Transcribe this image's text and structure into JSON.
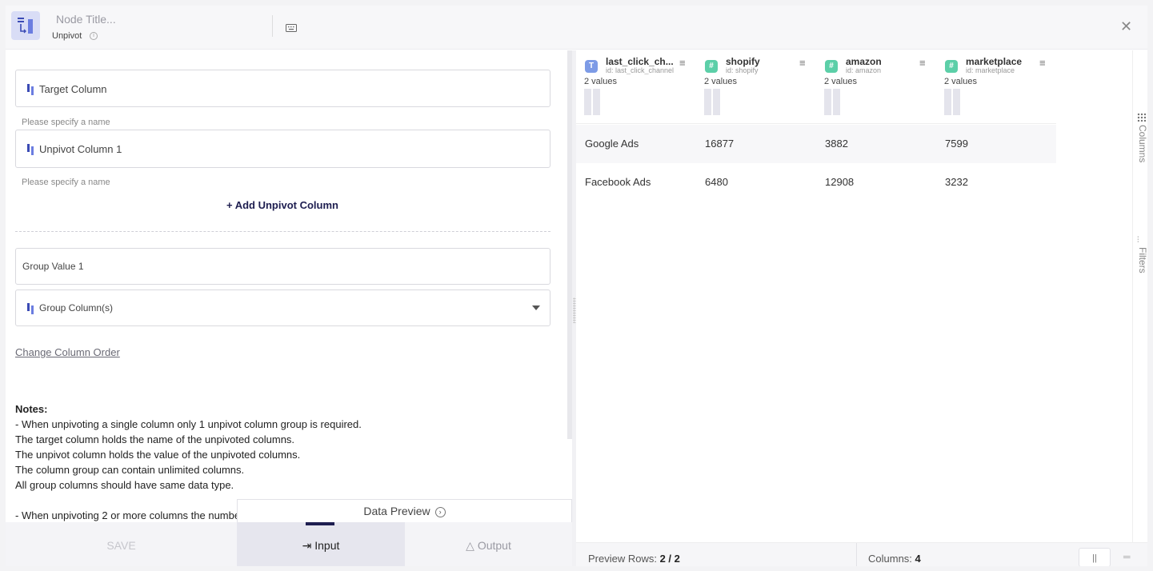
{
  "header": {
    "title_placeholder": "Node Title...",
    "node_type": "Unpivot"
  },
  "form": {
    "target_column": {
      "label": "Target Column",
      "helper": "Please specify a name"
    },
    "unpivot_column": {
      "label": "Unpivot Column 1",
      "helper": "Please specify a name"
    },
    "add_unpivot_label": "+ Add Unpivot Column",
    "group_value_label": "Group Value 1",
    "group_columns_label": "Group Column(s)",
    "change_order_label": "Change Column Order"
  },
  "notes": {
    "title": "Notes:",
    "lines": [
      "- When unpivoting a single column only 1 unpivot column group is required.",
      "The target column holds the name of the unpivoted columns.",
      "The unpivot column holds the value of the unpivoted columns.",
      "The column group can contain unlimited columns.",
      "All group columns should have same data type.",
      "",
      "- When unpivoting 2 or more columns the numbe"
    ]
  },
  "bottom": {
    "save_label": "SAVE",
    "input_label": "Input",
    "output_label": "Output",
    "data_preview_label": "Data Preview"
  },
  "grid": {
    "columns": [
      {
        "type": "T",
        "type_color": "#7d9be6",
        "name": "last_click_ch...",
        "id": "id: last_click_channel",
        "values": "2 values"
      },
      {
        "type": "#",
        "type_color": "#5ccfa8",
        "name": "shopify",
        "id": "id: shopify",
        "values": "2 values"
      },
      {
        "type": "#",
        "type_color": "#5ccfa8",
        "name": "amazon",
        "id": "id: amazon",
        "values": "2 values"
      },
      {
        "type": "#",
        "type_color": "#5ccfa8",
        "name": "marketplace",
        "id": "id: marketplace",
        "values": "2 values"
      }
    ],
    "rows": [
      [
        "Google Ads",
        "16877",
        "3882",
        "7599"
      ],
      [
        "Facebook Ads",
        "6480",
        "12908",
        "3232"
      ]
    ]
  },
  "rail": {
    "columns_label": "Columns",
    "filters_label": "Filters"
  },
  "footer": {
    "preview_rows_label": "Preview Rows:",
    "preview_rows_value": "2 / 2",
    "columns_label": "Columns:",
    "columns_value": "4"
  }
}
